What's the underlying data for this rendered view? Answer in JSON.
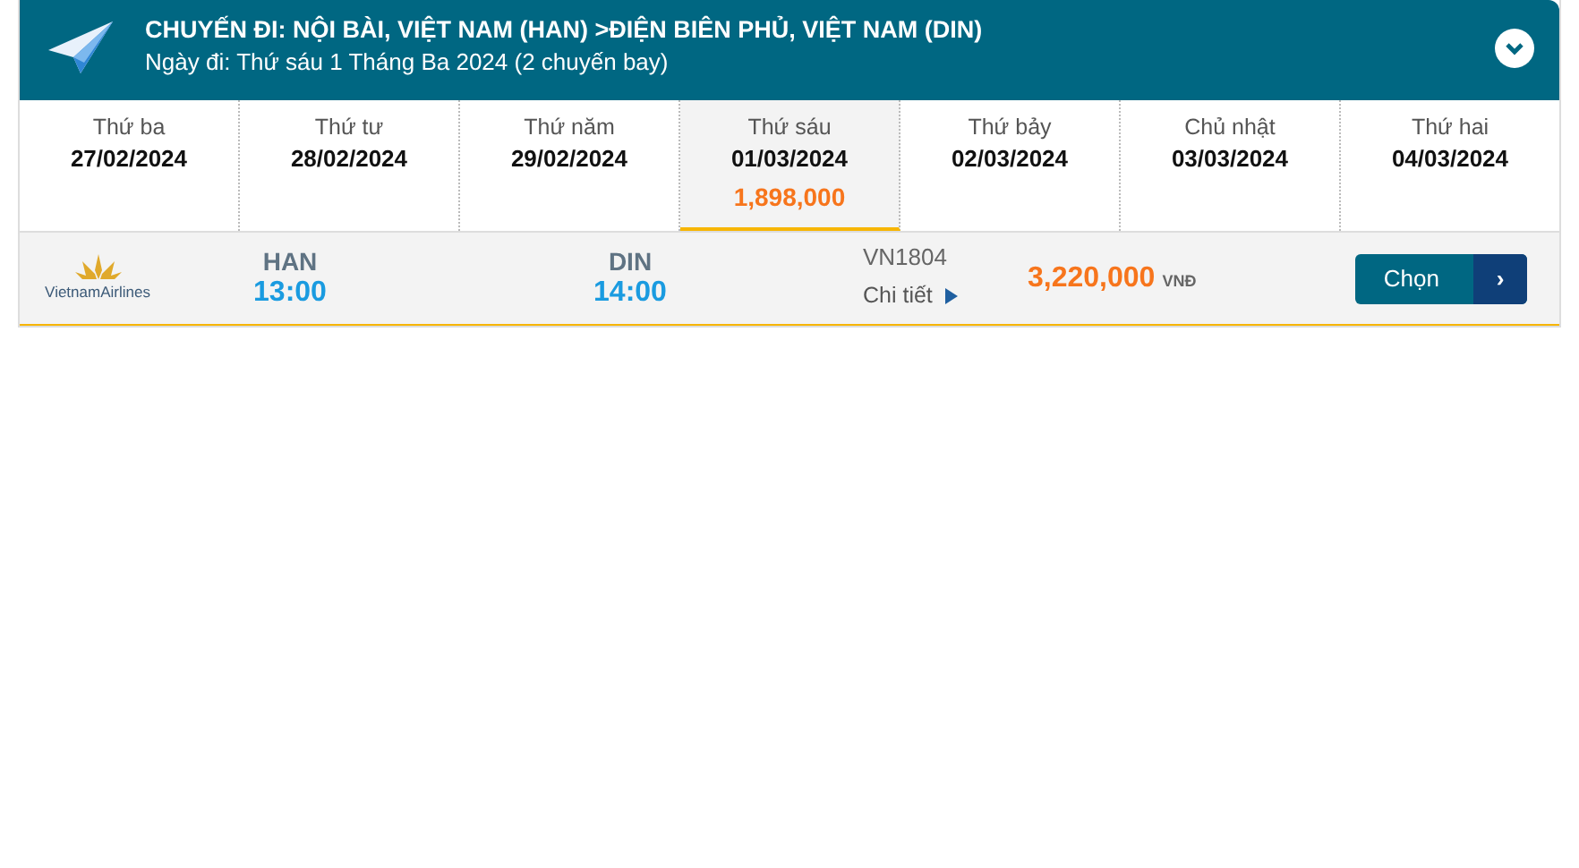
{
  "header": {
    "title": "CHUYẾN ĐI: NỘI BÀI, VIỆT NAM (HAN) >ĐIỆN BIÊN PHỦ, VIỆT NAM (DIN)",
    "subtitle": "Ngày đi: Thứ sáu 1 Tháng Ba 2024 (2 chuyến bay)"
  },
  "dates": [
    {
      "day": "Thứ ba",
      "date": "27/02/2024",
      "selected": false
    },
    {
      "day": "Thứ tư",
      "date": "28/02/2024",
      "selected": false
    },
    {
      "day": "Thứ năm",
      "date": "29/02/2024",
      "selected": false
    },
    {
      "day": "Thứ sáu",
      "date": "01/03/2024",
      "price": "1,898,000",
      "selected": true
    },
    {
      "day": "Thứ bảy",
      "date": "02/03/2024",
      "selected": false
    },
    {
      "day": "Chủ nhật",
      "date": "03/03/2024",
      "selected": false
    },
    {
      "day": "Thứ hai",
      "date": "04/03/2024",
      "selected": false
    }
  ],
  "flights": [
    {
      "airline": "VietnamAirlines",
      "from": "HAN",
      "depart": "13:00",
      "to": "DIN",
      "arrive": "14:00",
      "number": "VN1804",
      "details": "Chi tiết",
      "price": "3,220,000",
      "currency": "VNĐ",
      "button": "Chọn",
      "button_arrow": "›"
    }
  ]
}
